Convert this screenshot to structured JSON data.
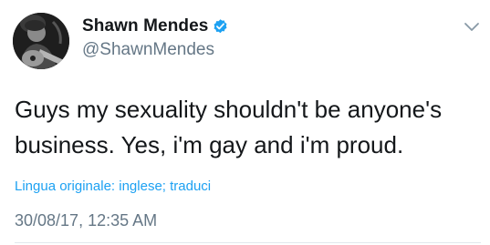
{
  "tweet": {
    "display_name": "Shawn Mendes",
    "handle": "@ShawnMendes",
    "verified": true,
    "text_line_1": "Guys my sexuality shouldn't be anyone's",
    "text_line_2": "business. Yes, i'm gay and i'm proud.",
    "translation_note": "Lingua originale: inglese; traduci",
    "timestamp": "30/08/17, 12:35 AM"
  },
  "icons": {
    "verified": "verified-badge-icon",
    "menu": "chevron-down-icon"
  },
  "colors": {
    "text": "#14171a",
    "secondary": "#657786",
    "link": "#1da1f2",
    "verified": "#1da1f2"
  }
}
